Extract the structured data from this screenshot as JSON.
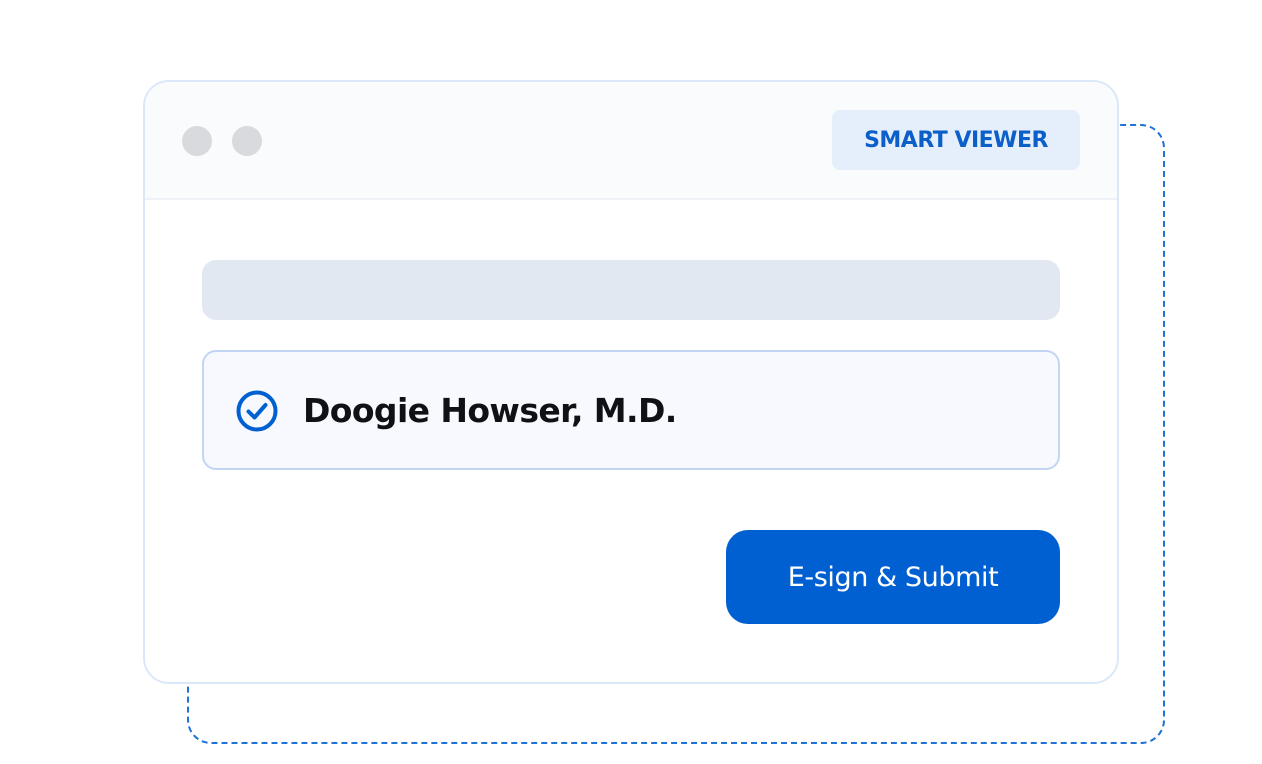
{
  "header": {
    "badge_label": "SMART VIEWER"
  },
  "signer": {
    "name": "Doogie Howser, M.D.",
    "checked": true,
    "icon": "check-circle-icon"
  },
  "actions": {
    "submit_label": "E-sign & Submit"
  },
  "colors": {
    "accent": "#0060d1",
    "badge_background": "#e5eefb",
    "dashed_outline": "#1f72d6",
    "window_dot": "#d8dadd",
    "placeholder": "#e1e8f1"
  }
}
